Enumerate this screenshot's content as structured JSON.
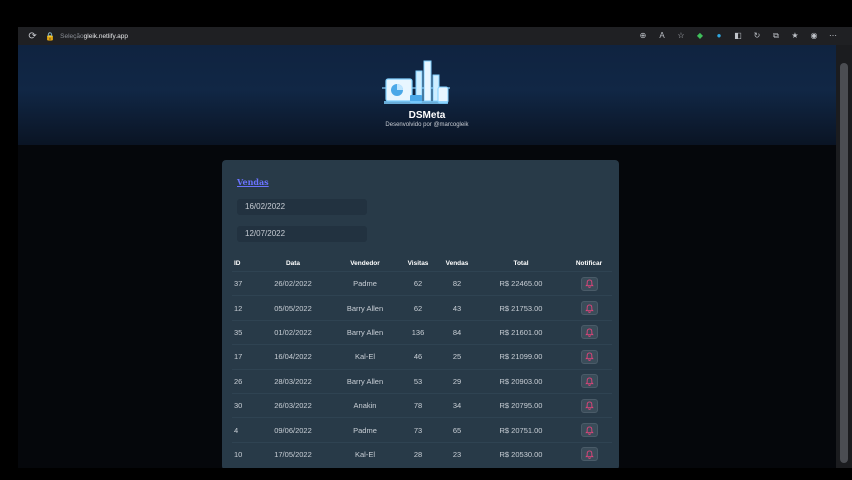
{
  "browser": {
    "url_prefix": "Seleção",
    "url_main": "gleik.netlify.app"
  },
  "header": {
    "brand": "DSMeta",
    "subtitle": "Desenvolvido por @marcogleik"
  },
  "card": {
    "title": "Vendas",
    "date_min": "16/02/2022",
    "date_max": "12/07/2022"
  },
  "table": {
    "headers": {
      "id": "ID",
      "date": "Data",
      "seller": "Vendedor",
      "visits": "Visitas",
      "sales": "Vendas",
      "total": "Total",
      "notify": "Notificar"
    },
    "rows": [
      {
        "id": "37",
        "date": "26/02/2022",
        "seller": "Padme",
        "visits": "62",
        "sales": "82",
        "total": "R$ 22465.00"
      },
      {
        "id": "12",
        "date": "05/05/2022",
        "seller": "Barry Allen",
        "visits": "62",
        "sales": "43",
        "total": "R$ 21753.00"
      },
      {
        "id": "35",
        "date": "01/02/2022",
        "seller": "Barry Allen",
        "visits": "136",
        "sales": "84",
        "total": "R$ 21601.00"
      },
      {
        "id": "17",
        "date": "16/04/2022",
        "seller": "Kal-El",
        "visits": "46",
        "sales": "25",
        "total": "R$ 21099.00"
      },
      {
        "id": "26",
        "date": "28/03/2022",
        "seller": "Barry Allen",
        "visits": "53",
        "sales": "29",
        "total": "R$ 20903.00"
      },
      {
        "id": "30",
        "date": "26/03/2022",
        "seller": "Anakin",
        "visits": "78",
        "sales": "34",
        "total": "R$ 20795.00"
      },
      {
        "id": "4",
        "date": "09/06/2022",
        "seller": "Padme",
        "visits": "73",
        "sales": "65",
        "total": "R$ 20751.00"
      },
      {
        "id": "10",
        "date": "17/05/2022",
        "seller": "Kal-El",
        "visits": "28",
        "sales": "23",
        "total": "R$ 20530.00"
      }
    ]
  },
  "colors": {
    "link": "#6a73ff",
    "card_bg": "#283a48",
    "notify_icon": "#e0457b"
  },
  "icons": {
    "reload": "reload-icon",
    "lock": "lock-icon",
    "notify": "bell-icon"
  }
}
